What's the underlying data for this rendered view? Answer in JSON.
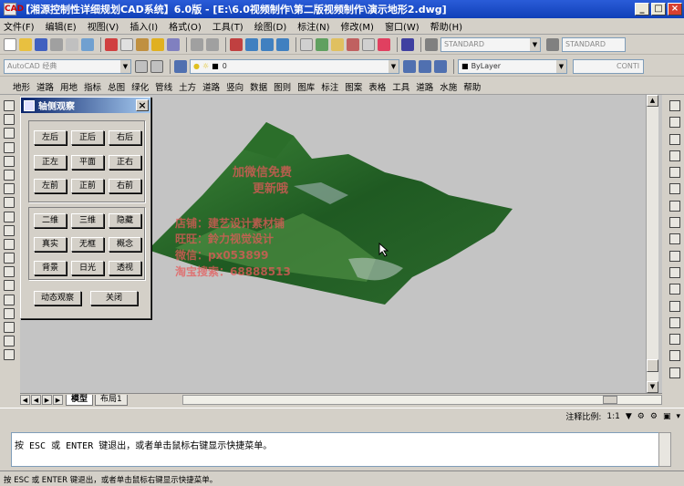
{
  "window": {
    "title": "【湘源控制性详细规划CAD系统】6.0版 - [E:\\6.0视频制作\\第二版视频制作\\演示地形2.dwg]",
    "app_icon": "CAD",
    "min": "_",
    "max": "□",
    "close": "×"
  },
  "menu": {
    "items": [
      "文件(F)",
      "编辑(E)",
      "视图(V)",
      "插入(I)",
      "格式(O)",
      "工具(T)",
      "绘图(D)",
      "标注(N)",
      "修改(M)",
      "窗口(W)",
      "帮助(H)"
    ]
  },
  "toolbar2": {
    "workspace": "AutoCAD 经典",
    "layer": "0",
    "linetype": "ByLayer",
    "textstyle": "STANDARD",
    "dimstyle": "STANDARD",
    "lineweight": "CONTI"
  },
  "menu2": {
    "items": [
      "地形",
      "道路",
      "用地",
      "指标",
      "总图",
      "绿化",
      "管线",
      "土方",
      "道路",
      "竖向",
      "数据",
      "图则",
      "图库",
      "标注",
      "图案",
      "表格",
      "工具",
      "道路",
      "水施",
      "帮助"
    ]
  },
  "dialog": {
    "title": "轴侧观察",
    "buttons": [
      "左后",
      "正后",
      "右后",
      "正左",
      "平面",
      "正右",
      "左前",
      "正前",
      "右前"
    ],
    "mode_buttons": [
      "二维",
      "三维",
      "隐藏",
      "真实",
      "无框",
      "概念",
      "背景",
      "日光",
      "透视"
    ],
    "dynamic": "动态观察",
    "close_label": "关闭",
    "close_x": "×"
  },
  "watermark": {
    "line1": "加微信免费",
    "line2": "更新哦",
    "line3": "店铺：建艺设计素材铺",
    "line4": "旺旺：鈴力视觉设计",
    "line5": "微信：px053899",
    "line6": "淘宝搜索：68888513"
  },
  "tabs": {
    "model": "模型",
    "layout": "布局1"
  },
  "status": {
    "scale_label": "注释比例:",
    "scale_value": "1:1"
  },
  "command": {
    "line": "按 ESC 或 ENTER 键退出，或者单击鼠标右键显示快捷菜单。"
  },
  "bottom_status": {
    "text": "按 ESC 或 ENTER 键退出，或者单击鼠标右键显示快捷菜单。"
  },
  "colors": {
    "title_bg": "#1040b8",
    "terrain_dark": "#1e5a1e",
    "terrain_light": "#4a8a3a",
    "canvas": "#c4c4c4"
  }
}
